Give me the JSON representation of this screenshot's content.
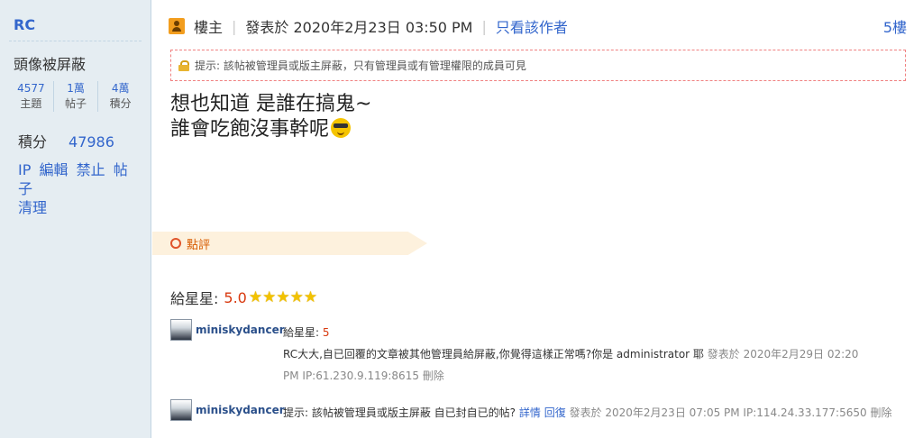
{
  "sidebar": {
    "username": "RC",
    "avatar_text": "頭像被屏蔽",
    "stats": [
      {
        "value": "4577",
        "label": "主題"
      },
      {
        "value": "1萬",
        "label": "帖子"
      },
      {
        "value": "4萬",
        "label": "積分"
      }
    ],
    "points_label": "積分",
    "points_value": "47986",
    "links": [
      "IP",
      "編輯",
      "禁止",
      "帖子",
      "清理"
    ]
  },
  "post": {
    "owner_label": "樓主",
    "posted_time": "發表於 2020年2月23日 03:50 PM",
    "only_author": "只看該作者",
    "floor": "5樓",
    "notice": "提示: 該帖被管理員或版主屏蔽，只有管理員或有管理權限的成員可見",
    "content_line1": "想也知道 是誰在搞鬼~",
    "content_line2": "誰會吃飽沒事幹呢"
  },
  "rating": {
    "tab_label": "點評",
    "stars_label": "給星星:",
    "score": "5.0",
    "star_count": 5
  },
  "comments": [
    {
      "user": "miniskydancer",
      "label": "給星星:",
      "score": "5",
      "text": "RC大大,自已回覆的文章被其他管理員給屏蔽,你覺得這樣正常嗎?你是 administrator 耶",
      "meta1": "發表於 2020年2月29日 02:20",
      "meta2": "PM IP:61.230.9.119:8615",
      "delete": "刪除"
    },
    {
      "user": "miniskydancer",
      "text": "提示: 該帖被管理員或版主屏蔽 自已封自已的帖?",
      "detail": "詳情",
      "reply": "回復",
      "meta": "發表於 2020年2月23日 07:05 PM IP:114.24.33.177:5650",
      "delete": "刪除"
    }
  ],
  "colors": {
    "link": "#3366cc",
    "sidebar_bg": "#e5edf2",
    "score": "#d8390f",
    "rate_tab_bg": "#fdf1dd"
  }
}
